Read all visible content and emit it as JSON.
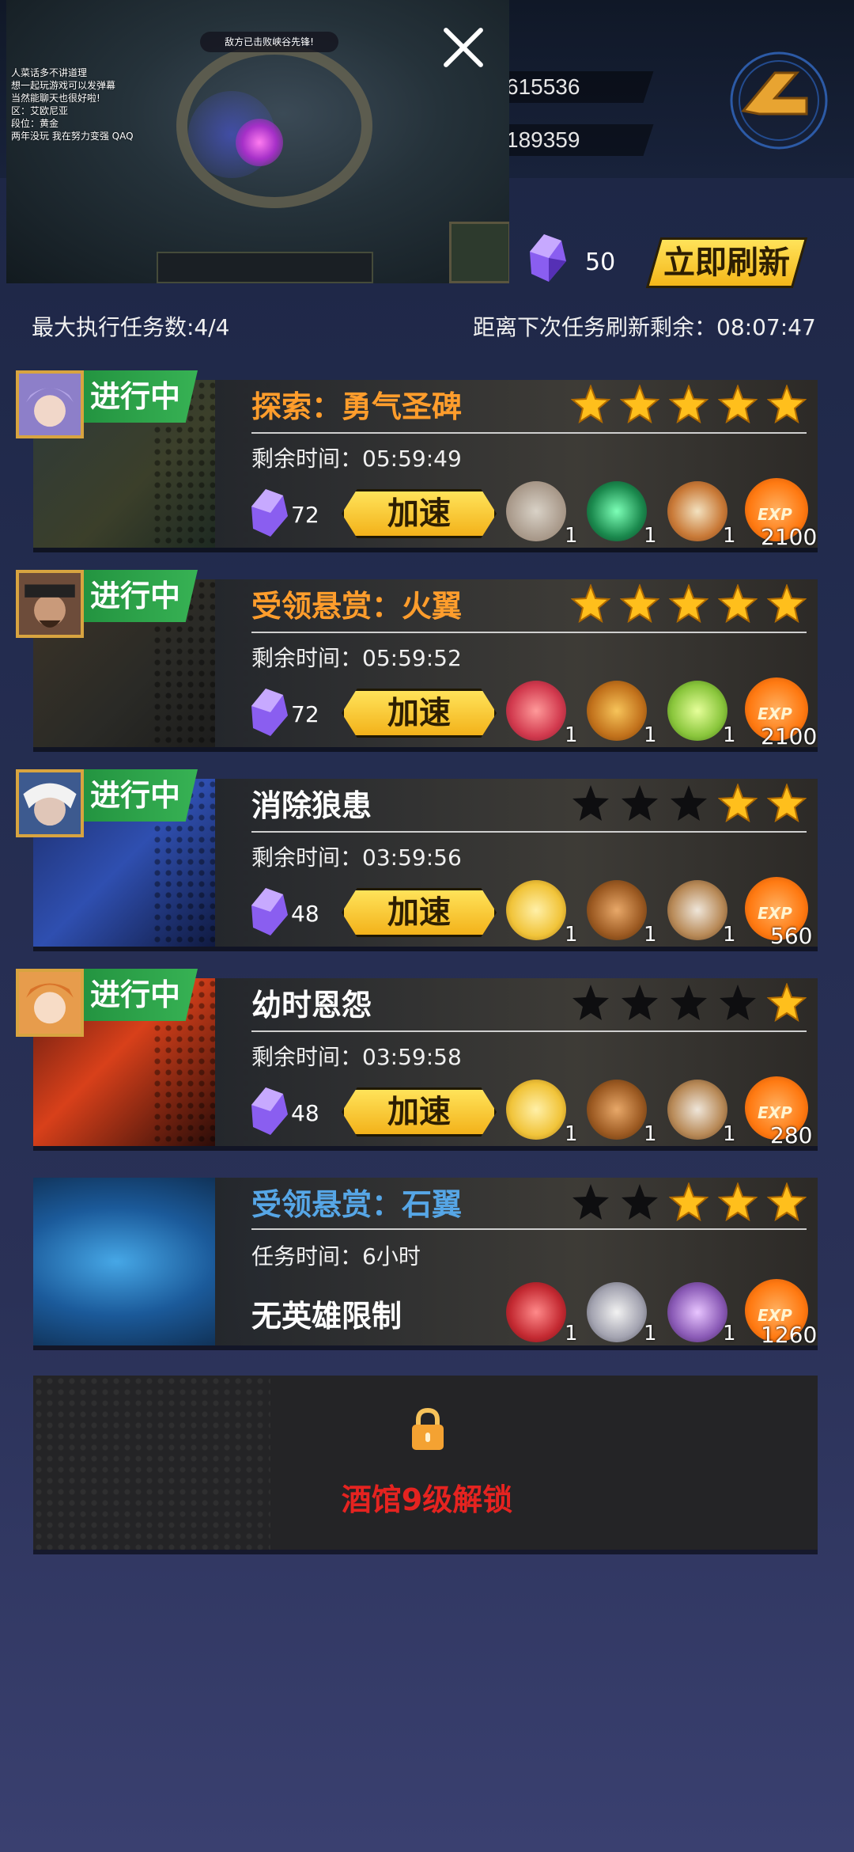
{
  "header": {
    "stat1": "615536",
    "stat2": "189359",
    "gem_count": "50",
    "refresh_label": "立即刷新"
  },
  "video_overlay": {
    "banner": "敌方已击败峡谷先锋!",
    "chat_lines": [
      "人菜话多不讲道理",
      "想一起玩游戏可以发弹幕",
      "当然能聊天也很好啦!",
      "区：艾欧尼亚",
      "段位：黄金",
      "两年没玩 我在努力变强 QAQ"
    ]
  },
  "info": {
    "max_tasks": "最大执行任务数:4/4",
    "next_refresh": "距离下次任务刷新剩余：08:07:47"
  },
  "quests": [
    {
      "status": "进行中",
      "title": "探索：勇气圣碑",
      "title_color": "orange",
      "stars_filled": 5,
      "stars_dark": 0,
      "time_label": "剩余时间：05:59:49",
      "cost": "72",
      "button": "加速",
      "rewards": [
        {
          "icon": "armor-icon",
          "qty": "1"
        },
        {
          "icon": "green-comet-icon",
          "qty": "1"
        },
        {
          "icon": "compass-icon",
          "qty": "1"
        }
      ],
      "exp": "2100"
    },
    {
      "status": "进行中",
      "title": "受领悬赏：火翼",
      "title_color": "orange",
      "stars_filled": 5,
      "stars_dark": 0,
      "time_label": "剩余时间：05:59:52",
      "cost": "72",
      "button": "加速",
      "rewards": [
        {
          "icon": "heart-potion-icon",
          "qty": "1"
        },
        {
          "icon": "horn-icon",
          "qty": "1"
        },
        {
          "icon": "poison-bottle-icon",
          "qty": "1"
        }
      ],
      "exp": "2100"
    },
    {
      "status": "进行中",
      "title": "消除狼患",
      "title_color": "white",
      "stars_filled": 2,
      "stars_dark": 3,
      "time_label": "剩余时间：03:59:56",
      "cost": "48",
      "button": "加速",
      "rewards": [
        {
          "icon": "star-coin-icon",
          "qty": "1"
        },
        {
          "icon": "boot-icon",
          "qty": "1"
        },
        {
          "icon": "claw-icon",
          "qty": "1"
        }
      ],
      "exp": "560"
    },
    {
      "status": "进行中",
      "title": "幼时恩怨",
      "title_color": "white",
      "stars_filled": 1,
      "stars_dark": 4,
      "time_label": "剩余时间：03:59:58",
      "cost": "48",
      "button": "加速",
      "rewards": [
        {
          "icon": "star-coin-icon",
          "qty": "1"
        },
        {
          "icon": "boot-icon",
          "qty": "1"
        },
        {
          "icon": "claw-icon",
          "qty": "1"
        }
      ],
      "exp": "280"
    },
    {
      "title": "受领悬赏：石翼",
      "title_color": "blue",
      "stars_filled": 3,
      "stars_dark": 2,
      "time_label": "任务时间：6小时",
      "restriction": "无英雄限制",
      "rewards": [
        {
          "icon": "ring-icon",
          "qty": "1"
        },
        {
          "icon": "sword-icon",
          "qty": "1"
        },
        {
          "icon": "shuriken-icon",
          "qty": "1"
        }
      ],
      "exp": "1260"
    }
  ],
  "locked_slot": {
    "text": "酒馆9级解锁"
  },
  "exp_badge": "EXP",
  "colors": {
    "accent": "#f4b619",
    "status_green": "#37b254",
    "title_orange": "#ff9d2c",
    "title_blue": "#56a6e6",
    "lock_red": "#e52320"
  }
}
